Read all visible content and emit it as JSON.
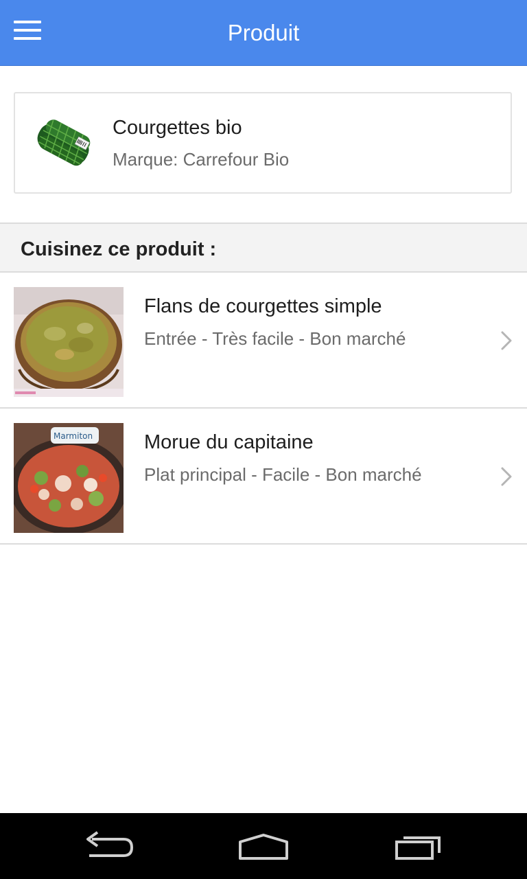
{
  "appbar": {
    "title": "Produit",
    "menu_icon": "hamburger-menu-icon",
    "color": "#4a88ec"
  },
  "product": {
    "name": "Courgettes bio",
    "brand": "Marque: Carrefour Bio",
    "image_icon": "courgettes-product-image"
  },
  "section": {
    "title": "Cuisinez ce produit :"
  },
  "recipes": [
    {
      "title": "Flans de courgettes simple",
      "meta": "Entrée - Très facile - Bon marché",
      "image_icon": "flan-photo"
    },
    {
      "title": "Morue du capitaine",
      "meta": "Plat principal - Facile - Bon marché",
      "image_icon": "cod-dish-photo"
    }
  ],
  "navbar": {
    "back_icon": "back-icon",
    "home_icon": "home-icon",
    "recents_icon": "recents-icon"
  }
}
